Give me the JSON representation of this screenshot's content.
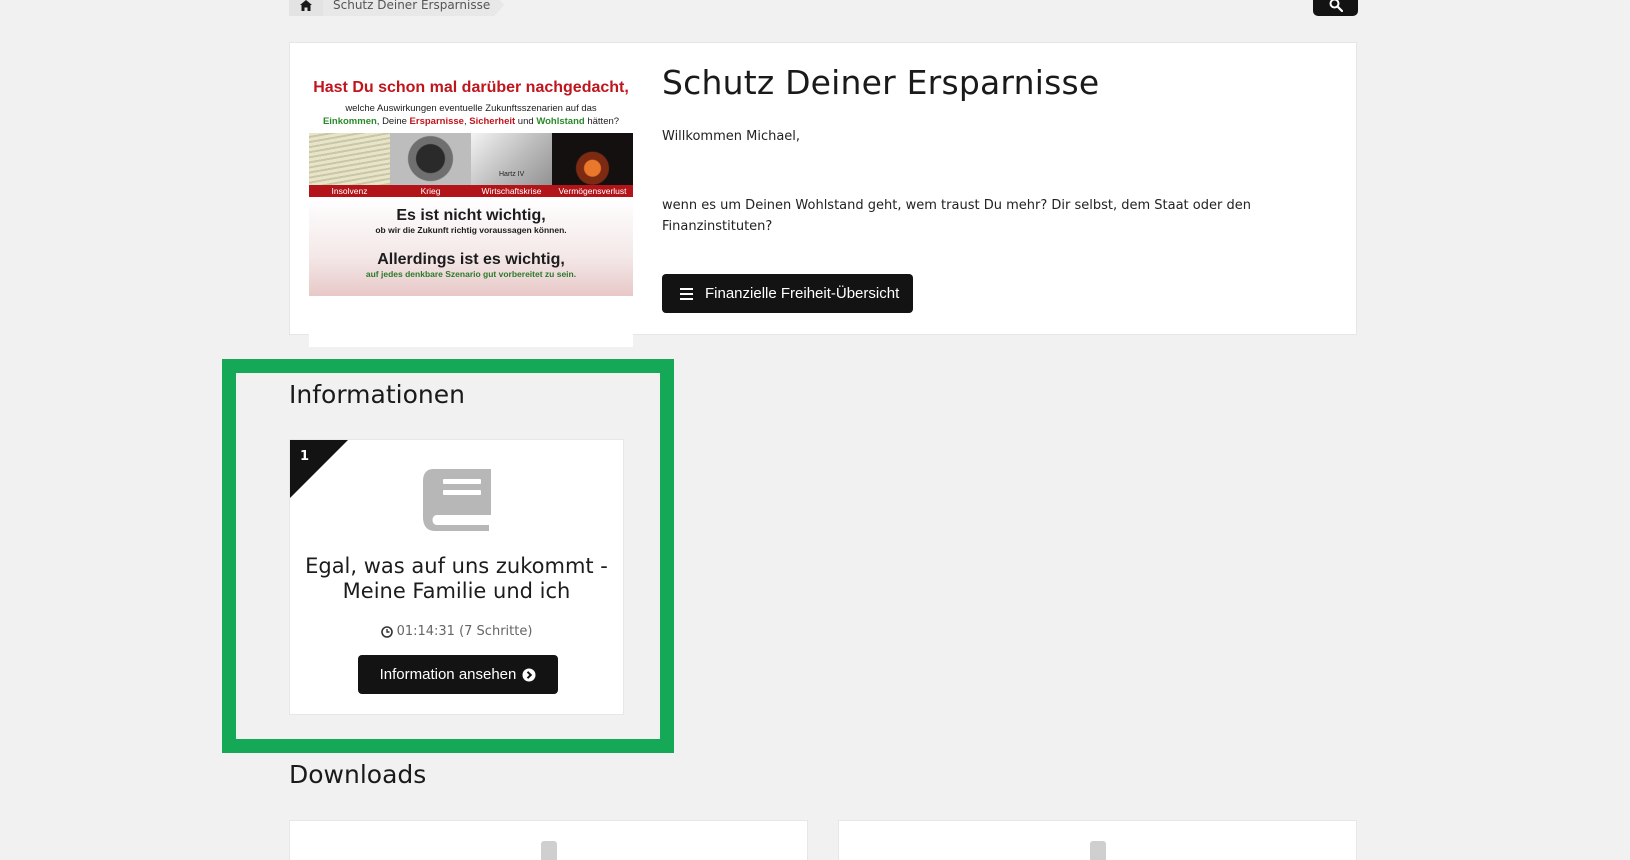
{
  "breadcrumb": {
    "home_icon": "home-icon",
    "current": "Schutz Deiner Ersparnisse"
  },
  "search": {
    "icon": "search-icon"
  },
  "hero": {
    "title": "Schutz Deiner Ersparnisse",
    "welcome": "Willkommen Michael,",
    "question": "wenn es um Deinen Wohlstand geht, wem traust Du mehr? Dir selbst, dem Staat oder den Finanzinstituten?",
    "button_label": "Finanzielle Freiheit-Übersicht",
    "image": {
      "headline": "Hast Du schon mal darüber nachgedacht,",
      "subline1": "welche Auswirkungen eventuelle Zukunftsszenarien auf das",
      "subline2_parts": [
        "Einkommen",
        ", Deine ",
        "Ersparnisse",
        ", ",
        "Sicherheit",
        " und ",
        "Wohlstand",
        " hätten?"
      ],
      "photo_tags": [
        "Insolvenz",
        "Krieg",
        "Wirtschaftskrise",
        "Vermögensverlust"
      ],
      "photo_overlay": "Hartz IV",
      "bottom_big1": "Es ist nicht wichtig,",
      "bottom_small1": "ob wir die Zukunft richtig voraussagen können.",
      "bottom_big2": "Allerdings ist es wichtig,",
      "bottom_small2": "auf jedes denkbare Szenario gut vorbereitet zu sein."
    }
  },
  "informationen": {
    "heading": "Informationen",
    "card": {
      "number": "1",
      "icon": "book-icon",
      "title": "Egal, was auf uns zukommt - Meine Familie und ich",
      "duration": "01:14:31 (7 Schritte)",
      "button_label": "Information ansehen"
    }
  },
  "downloads": {
    "heading": "Downloads"
  },
  "colors": {
    "highlight": "#14a857",
    "button": "#131313",
    "background": "#f1f1f1"
  }
}
